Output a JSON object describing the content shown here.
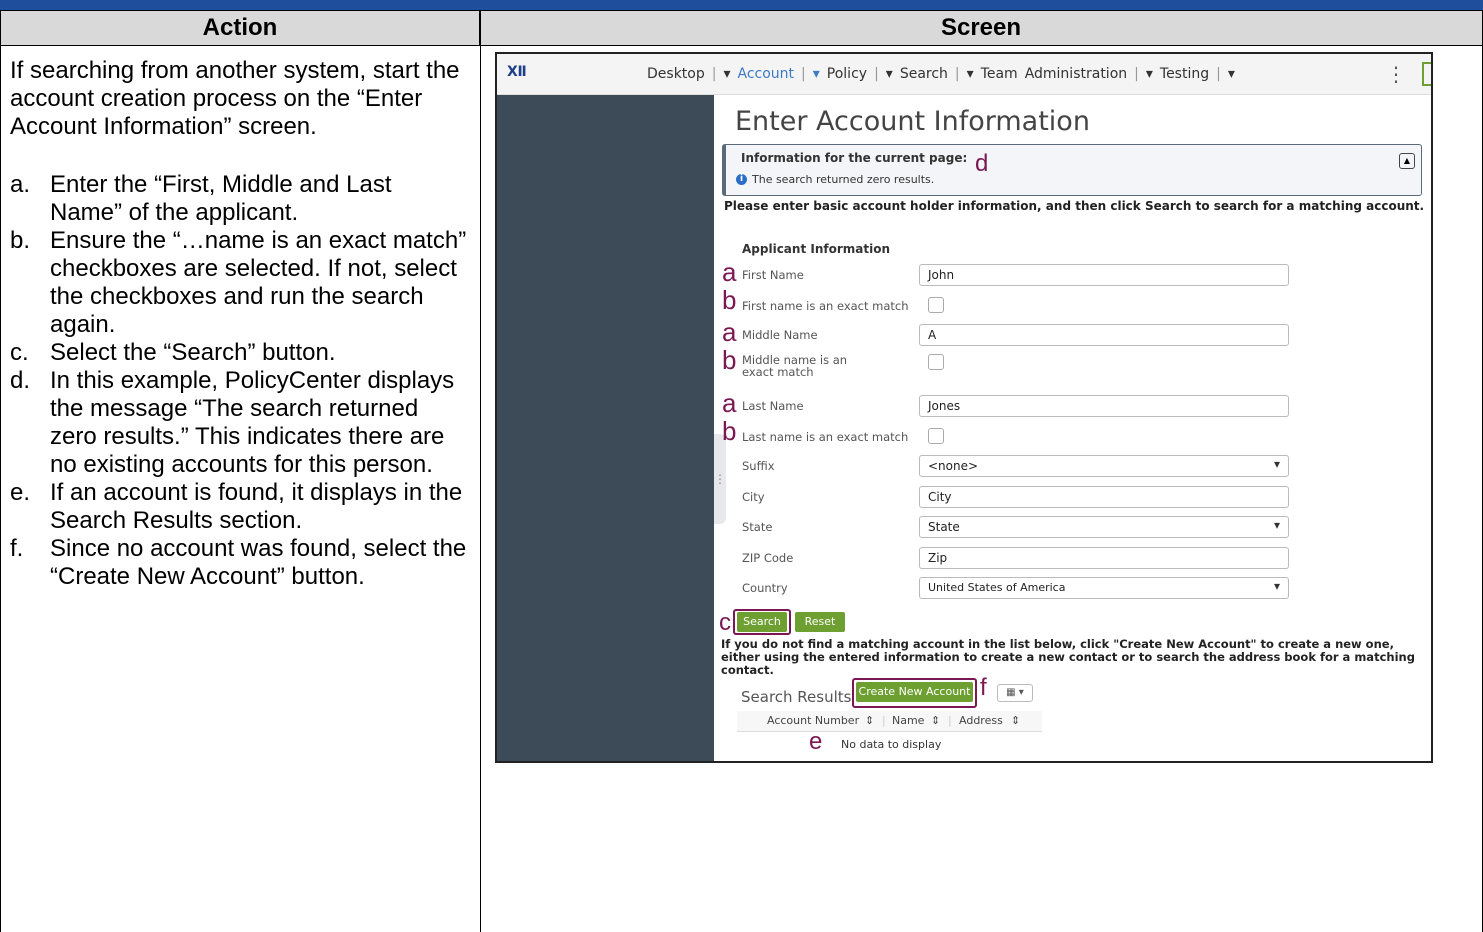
{
  "headers": {
    "action": "Action",
    "screen": "Screen"
  },
  "action_intro": "If searching from another system, start the account creation process on the “Enter Account Information” screen.",
  "steps": [
    {
      "letter": "a.",
      "text": "Enter the “First, Middle and Last Name” of the applicant."
    },
    {
      "letter": "b.",
      "text": "Ensure the “…name is an exact match” checkboxes are selected.  If not, select the checkboxes and run the search again."
    },
    {
      "letter": "c.",
      "text": "Select the “Search” button."
    },
    {
      "letter": "d.",
      "text": "In this example, PolicyCenter displays the message “The search returned zero results.” This indicates there are no existing accounts for this person."
    },
    {
      "letter": "e.",
      "text": "If an account is found, it displays in the Search Results section."
    },
    {
      "letter": "f.",
      "text": "Since no account was found, select the “Create New Account” button."
    }
  ],
  "app": {
    "nav": {
      "desktop": "Desktop",
      "account": "Account",
      "policy": "Policy",
      "search": "Search",
      "team": "Team",
      "administration": "Administration",
      "testing": "Testing"
    },
    "page_title": "Enter Account Information",
    "message_box": {
      "title": "Information for the current page:",
      "message": "The search returned zero results."
    },
    "intro": "Please enter basic account holder information, and then click Search to search for a matching account.",
    "section_title": "Applicant Information",
    "fields": {
      "first_name": {
        "label": "First Name",
        "value": "John"
      },
      "first_exact": {
        "label": "First name is an exact match"
      },
      "middle_name": {
        "label": "Middle Name",
        "value": "A"
      },
      "middle_exact": {
        "label": "Middle name is an exact match"
      },
      "last_name": {
        "label": "Last Name",
        "value": "Jones"
      },
      "last_exact": {
        "label": "Last name is an exact match"
      },
      "suffix": {
        "label": "Suffix",
        "value": "<none>"
      },
      "city": {
        "label": "City",
        "value": "City"
      },
      "state": {
        "label": "State",
        "value": "State"
      },
      "zip": {
        "label": "ZIP Code",
        "value": "Zip"
      },
      "country": {
        "label": "Country",
        "value": "United States of America"
      }
    },
    "buttons": {
      "search": "Search",
      "reset": "Reset",
      "create_new_account": "Create New Account"
    },
    "results_note": "If you do not find a matching account in the list below, click \"Create New Account\" to create a new one, either using the entered information to create a new contact or to search the address book for a matching contact.",
    "search_results_title": "Search Results",
    "columns": [
      "Account Number",
      "Name",
      "Address"
    ],
    "no_data": "No data to display"
  },
  "annotations": {
    "a": "a",
    "b": "b",
    "c": "c",
    "d": "d",
    "e": "e",
    "f": "f"
  },
  "colors": {
    "annotation": "#7b1853",
    "button_green": "#6d9f31",
    "header_band": "#1f4e9c"
  }
}
